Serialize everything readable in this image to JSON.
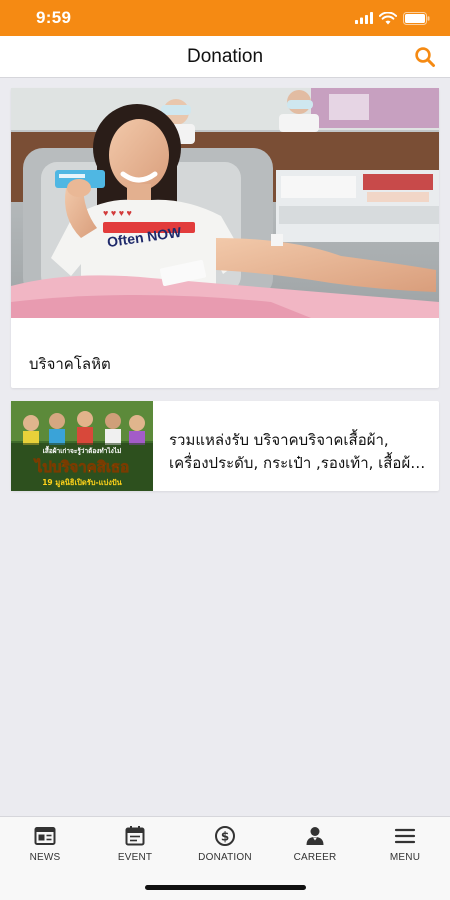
{
  "status_bar": {
    "time": "9:59"
  },
  "header": {
    "title": "Donation"
  },
  "items": [
    {
      "title": "บริจาคโลหิต"
    },
    {
      "title": "รวมแหล่งรับ บริจาคบริจาคเสื้อผ้า, เครื่องประดับ, กระเป๋า ,รองเท้า, เสื้อผ้าเด็ก"
    }
  ],
  "tabs": [
    {
      "label": "NEWS",
      "icon": "news-icon"
    },
    {
      "label": "EVENT",
      "icon": "calendar-icon"
    },
    {
      "label": "DONATION",
      "icon": "dollar-coin-icon"
    },
    {
      "label": "CAREER",
      "icon": "person-icon"
    },
    {
      "label": "MENU",
      "icon": "hamburger-menu-icon"
    }
  ],
  "thumbnail_texts": {
    "shirt_text": "Often NOW",
    "banner_line1": "เสื้อผ้าเก่าจะรู้ว่าต้องทำไงไม่",
    "banner_line2": "ไปบริจาคสิเธอ",
    "banner_line3": "19 มูลนิธิเปิดรับ-แบ่งปัน"
  },
  "colors": {
    "accent": "#f58a13",
    "background": "#ebebf0",
    "card": "#ffffff"
  }
}
